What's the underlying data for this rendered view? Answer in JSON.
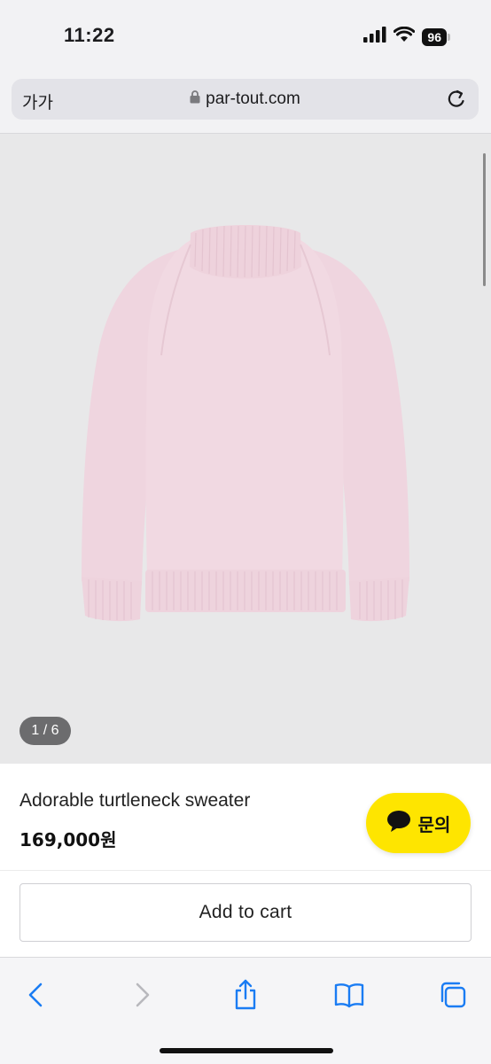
{
  "status_bar": {
    "time": "11:22",
    "battery": "96"
  },
  "browser": {
    "text_size_label": "가가",
    "url": "par-tout.com"
  },
  "gallery": {
    "counter": "1 / 6"
  },
  "product": {
    "name": "Adorable turtleneck sweater",
    "price": "169,000원",
    "inquiry_label": "문의",
    "add_to_cart_label": "Add to cart"
  },
  "colors": {
    "accent_blue": "#1a7cf3",
    "kakao_yellow": "#fee500",
    "sweater_pink": "#f1d9e2",
    "image_background": "#e8e8e9"
  },
  "icons": {
    "status": [
      "signal-icon",
      "wifi-icon",
      "battery-icon"
    ],
    "address_bar": [
      "lock-icon",
      "reload-icon"
    ],
    "toolbar": [
      "back-icon",
      "forward-icon",
      "share-icon",
      "bookmarks-icon",
      "tabs-icon"
    ],
    "inquiry": "chat-bubble-icon"
  }
}
